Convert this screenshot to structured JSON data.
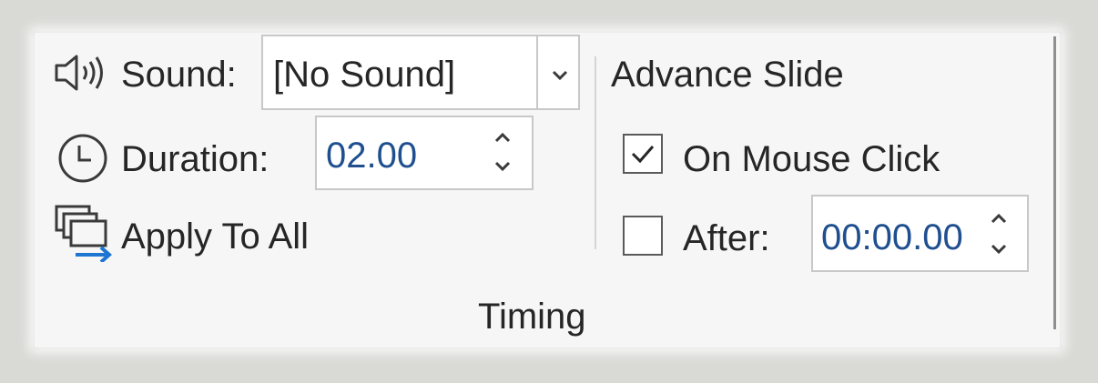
{
  "sound": {
    "label": "Sound:",
    "value": "[No Sound]",
    "icon": "speaker-icon"
  },
  "duration": {
    "label": "Duration:",
    "value": "02.00",
    "icon": "clock-icon"
  },
  "apply": {
    "label": "Apply To All",
    "icon": "apply-to-all-icon"
  },
  "advance": {
    "title": "Advance Slide",
    "on_mouse_click": {
      "label": "On Mouse Click",
      "checked": true
    },
    "after": {
      "label": "After:",
      "checked": false,
      "value": "00:00.00"
    }
  },
  "group": {
    "label": "Timing"
  },
  "colors": {
    "accent": "#1e76d2",
    "text": "#262626",
    "panel": "#f6f6f6"
  }
}
